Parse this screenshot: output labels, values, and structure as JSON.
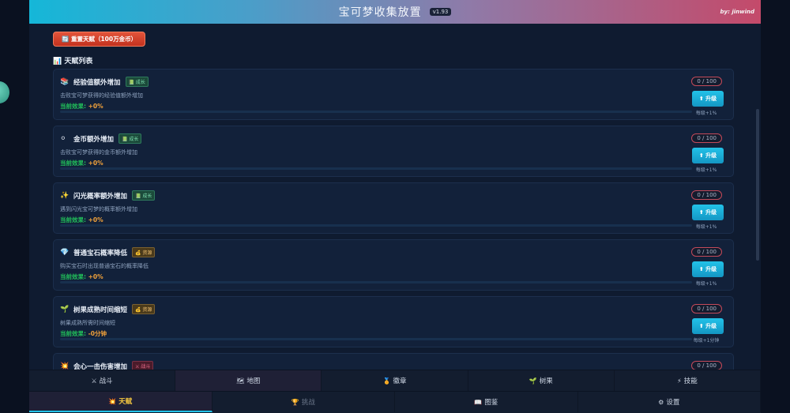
{
  "header": {
    "title": "宝可梦收集放置",
    "version": "v1.93",
    "author": "by: jinwind"
  },
  "reset_button": "🔄 重置天赋（100万金币）",
  "section_title": "📊 天赋列表",
  "talents": [
    {
      "icon": "📚",
      "icon_name": "book-icon",
      "name": "经验值额外增加",
      "tag": "📗 成长",
      "tag_type": "growth",
      "desc": "击败宝可梦获得的经验值额外增加",
      "effect_label": "当前效果:",
      "effect_value": "+0%",
      "level": "0 / 100",
      "upgrade_label": "⬆ 升级",
      "upgrade_note": "每级+1%"
    },
    {
      "icon": "⚪",
      "icon_name": "coin-icon",
      "name": "金币额外增加",
      "tag": "📗 成长",
      "tag_type": "growth",
      "desc": "击败宝可梦获得的金币额外增加",
      "effect_label": "当前效果:",
      "effect_value": "+0%",
      "level": "0 / 100",
      "upgrade_label": "⬆ 升级",
      "upgrade_note": "每级+1%"
    },
    {
      "icon": "✨",
      "icon_name": "sparkle-icon",
      "name": "闪光概率额外增加",
      "tag": "📗 成长",
      "tag_type": "growth",
      "desc": "遇到闪光宝可梦的概率额外增加",
      "effect_label": "当前效果:",
      "effect_value": "+0%",
      "level": "0 / 100",
      "upgrade_label": "⬆ 升级",
      "upgrade_note": "每级+1%"
    },
    {
      "icon": "💎",
      "icon_name": "gem-icon",
      "name": "普通宝石概率降低",
      "tag": "💰 资源",
      "tag_type": "resource",
      "desc": "购买宝石时出现普通宝石的概率降低",
      "effect_label": "当前效果:",
      "effect_value": "+0%",
      "level": "0 / 100",
      "upgrade_label": "⬆ 升级",
      "upgrade_note": "每级+1%"
    },
    {
      "icon": "🌱",
      "icon_name": "sprout-icon",
      "name": "树果成熟时间缩短",
      "tag": "💰 资源",
      "tag_type": "resource",
      "desc": "树果成熟所需时间缩短",
      "effect_label": "当前效果:",
      "effect_value": "-0分钟",
      "level": "0 / 100",
      "upgrade_label": "⬆ 升级",
      "upgrade_note": "每级+1分钟"
    },
    {
      "icon": "💥",
      "icon_name": "burst-icon",
      "name": "会心一击伤害增加",
      "tag": "⚔ 战斗",
      "tag_type": "battle",
      "desc": "",
      "effect_label": "",
      "effect_value": "",
      "level": "0 / 100",
      "upgrade_label": "",
      "upgrade_note": ""
    }
  ],
  "nav": {
    "row1": [
      {
        "icon": "⚔",
        "icon_name": "swords-icon",
        "label": "战斗"
      },
      {
        "icon": "🗺",
        "icon_name": "map-icon",
        "label": "地图"
      },
      {
        "icon": "🏅",
        "icon_name": "medal-icon",
        "label": "徽章"
      },
      {
        "icon": "🌱",
        "icon_name": "sprout-icon",
        "label": "树果"
      },
      {
        "icon": "⚡",
        "icon_name": "lightning-icon",
        "label": "技能"
      }
    ],
    "row2": [
      {
        "icon": "💥",
        "icon_name": "burst-icon",
        "label": "天赋"
      },
      {
        "icon": "🏆",
        "icon_name": "trophy-icon",
        "label": "挑战"
      },
      {
        "icon": "📖",
        "icon_name": "book-icon",
        "label": "图鉴"
      },
      {
        "icon": "⚙",
        "icon_name": "gear-icon",
        "label": "设置"
      }
    ]
  },
  "colors": {
    "accent": "#22c2e8",
    "effect": "#21c05a",
    "value": "#f2a23a",
    "reset": "#d9432c"
  }
}
